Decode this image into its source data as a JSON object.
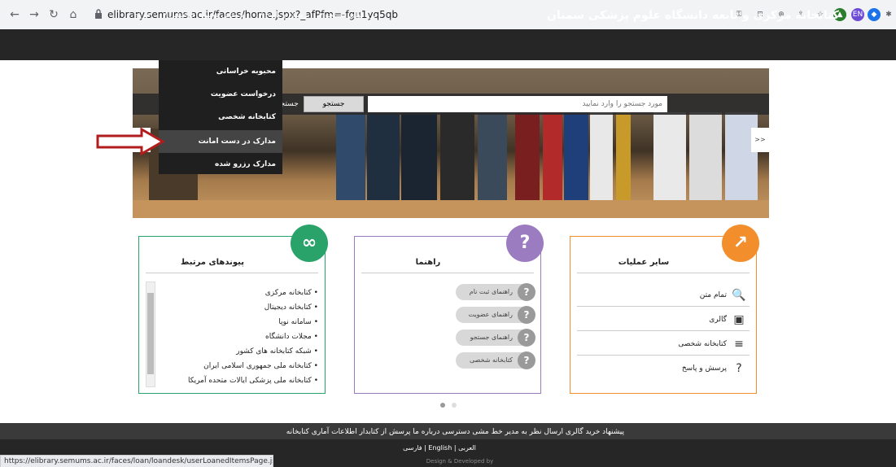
{
  "browser": {
    "url": "elibrary.semums.ac.ir/faces/home.jspx?_afPfm=-fgu1yq5qb",
    "status_url": "https://elibrary.semums.ac.ir/faces/loan/loandesk/userLoanedItemsPage.jspx",
    "profile_initials": "EN"
  },
  "header": {
    "title": "کتابخانه مرکزی و تابعه دانشگاه علوم پزشکی سمنان",
    "nav": {
      "portals": "درگاههای جستجو ▾",
      "qa": "پرسش و پاسخ ▾",
      "profile": "پروفایل محبوبه خراسانی ▾",
      "logout": "خروج"
    }
  },
  "dropdown": {
    "items": [
      {
        "label": "محبوبه خراسانی"
      },
      {
        "label": "درخواست عضویت"
      },
      {
        "label": "کتابخانه شخصی"
      },
      {
        "label": "مدارک در دست امانت"
      },
      {
        "label": "مدارک رزرو شده"
      }
    ]
  },
  "search": {
    "placeholder": "مورد جستجو را وارد نمایید",
    "button": "جستجو",
    "side_label": "جستجو",
    "prev": "<<",
    "next": ">>"
  },
  "cards": {
    "links": {
      "title": "پیوندهای مرتبط",
      "items": [
        "• کتابخانه مرکزی",
        "• کتابخانه دیجیتال",
        "• سامانه نوپا",
        "• مجلات دانشگاه",
        "• شبکه کتابخانه های کشور",
        "• کتابخانه ملی جمهوری اسلامی ایران",
        "• کتابخانه ملی پزشکی ایالات متحده آمریکا"
      ]
    },
    "guide": {
      "title": "راهنما",
      "items": [
        "راهنمای ثبت نام",
        "راهنمای عضویت",
        "راهنمای جستجو",
        "کتابخانه شخصی"
      ]
    },
    "ops": {
      "title": "سایر عملیات",
      "items": [
        "تمام متن",
        "گالری",
        "کتابخانه شخصی",
        "پرسش و پاسخ"
      ]
    }
  },
  "footer": {
    "links": "پیشنهاد خرید   گالری   ارسال نظر به مدیر   خط مشی دسترسی   درباره ما   پرسش از کتابدار   اطلاعات آماری کتابخانه",
    "langs": "فارسی | English | العربی",
    "credits": "Design & Developed by"
  },
  "colors": {
    "links_accent": "#2aa36b",
    "guide_accent": "#9b7cc0",
    "ops_accent": "#f28f2c"
  }
}
